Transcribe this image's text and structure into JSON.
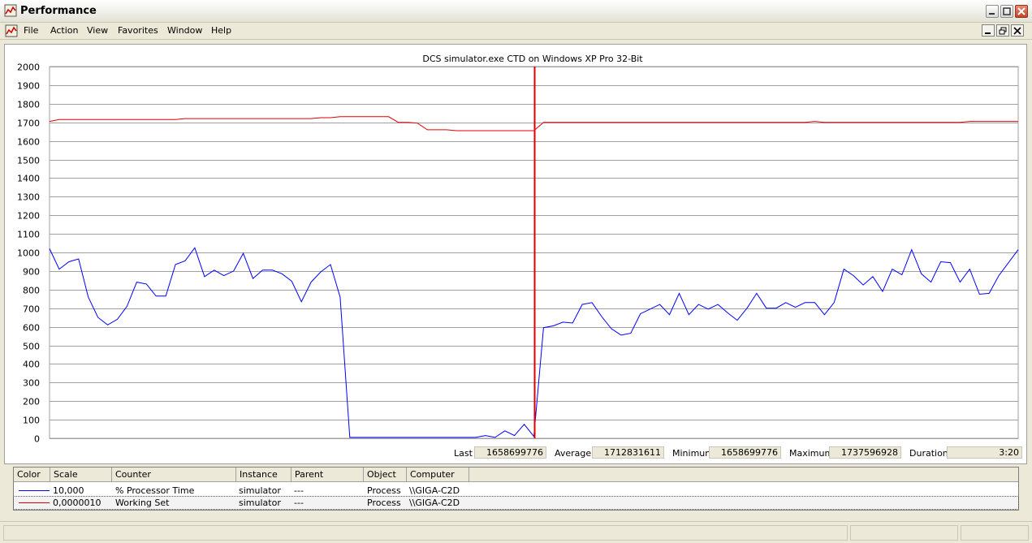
{
  "window": {
    "title": "Performance",
    "menu": [
      "File",
      "Action",
      "View",
      "Favorites",
      "Window",
      "Help"
    ]
  },
  "graph": {
    "title": "DCS simulator.exe CTD on Windows XP Pro 32-Bit",
    "colors": {
      "processor": "#0000ff",
      "working_set": "#e00000",
      "cursor": "#e00000",
      "grid": "#a0a0a0"
    }
  },
  "stats": {
    "last_label": "Last",
    "last_value": "1658699776",
    "average_label": "Average",
    "average_value": "1712831611",
    "minimum_label": "Minimum",
    "minimum_value": "1658699776",
    "maximum_label": "Maximum",
    "maximum_value": "1737596928",
    "duration_label": "Duration",
    "duration_value": "3:20"
  },
  "legend": {
    "headers": [
      "Color",
      "Scale",
      "Counter",
      "Instance",
      "Parent",
      "Object",
      "Computer"
    ],
    "rows": [
      {
        "color": "#0000ff",
        "scale": "10,000",
        "counter": "% Processor Time",
        "instance": "simulator",
        "parent": "---",
        "object": "Process",
        "computer": "\\\\GIGA-C2D"
      },
      {
        "color": "#e00000",
        "scale": "0,0000010",
        "counter": "Working Set",
        "instance": "simulator",
        "parent": "---",
        "object": "Process",
        "computer": "\\\\GIGA-C2D"
      }
    ]
  },
  "chart_data": {
    "type": "line",
    "title": "DCS simulator.exe CTD on Windows XP Pro 32-Bit",
    "xlabel": "",
    "ylabel": "",
    "ylim": [
      0,
      2000
    ],
    "yticks": [
      0,
      100,
      200,
      300,
      400,
      500,
      600,
      700,
      800,
      900,
      1000,
      1100,
      1200,
      1300,
      1400,
      1500,
      1600,
      1700,
      1800,
      1900,
      2000
    ],
    "grid": true,
    "samples": 101,
    "cursor_index": 50,
    "series": [
      {
        "name": "% Processor Time",
        "values": [
          1020,
          910,
          950,
          965,
          760,
          650,
          610,
          640,
          710,
          840,
          830,
          765,
          765,
          935,
          955,
          1025,
          870,
          905,
          875,
          900,
          995,
          860,
          905,
          905,
          885,
          845,
          735,
          840,
          895,
          935,
          760,
          5,
          5,
          5,
          5,
          5,
          5,
          5,
          5,
          5,
          5,
          5,
          5,
          5,
          5,
          15,
          5,
          40,
          15,
          75,
          10,
          595,
          605,
          625,
          620,
          720,
          730,
          655,
          590,
          555,
          565,
          670,
          695,
          720,
          665,
          780,
          665,
          720,
          695,
          720,
          675,
          635,
          700,
          780,
          700,
          700,
          730,
          705,
          730,
          730,
          665,
          730,
          910,
          875,
          825,
          870,
          790,
          910,
          880,
          1015,
          885,
          840,
          950,
          945,
          840,
          910,
          775,
          780,
          875,
          945,
          1015
        ]
      },
      {
        "name": "Working Set",
        "values": [
          1705,
          1715,
          1715,
          1715,
          1715,
          1715,
          1715,
          1715,
          1715,
          1715,
          1715,
          1715,
          1715,
          1715,
          1720,
          1720,
          1720,
          1720,
          1720,
          1720,
          1720,
          1720,
          1720,
          1720,
          1720,
          1720,
          1720,
          1720,
          1725,
          1725,
          1730,
          1730,
          1730,
          1730,
          1730,
          1730,
          1700,
          1700,
          1695,
          1660,
          1660,
          1660,
          1655,
          1655,
          1655,
          1655,
          1655,
          1655,
          1655,
          1655,
          1655,
          1700,
          1700,
          1700,
          1700,
          1700,
          1700,
          1700,
          1700,
          1700,
          1700,
          1700,
          1700,
          1700,
          1700,
          1700,
          1700,
          1700,
          1700,
          1700,
          1700,
          1700,
          1700,
          1700,
          1700,
          1700,
          1700,
          1700,
          1700,
          1705,
          1700,
          1700,
          1700,
          1700,
          1700,
          1700,
          1700,
          1700,
          1700,
          1700,
          1700,
          1700,
          1700,
          1700,
          1700,
          1705,
          1705,
          1705,
          1705,
          1705,
          1705
        ]
      }
    ]
  }
}
